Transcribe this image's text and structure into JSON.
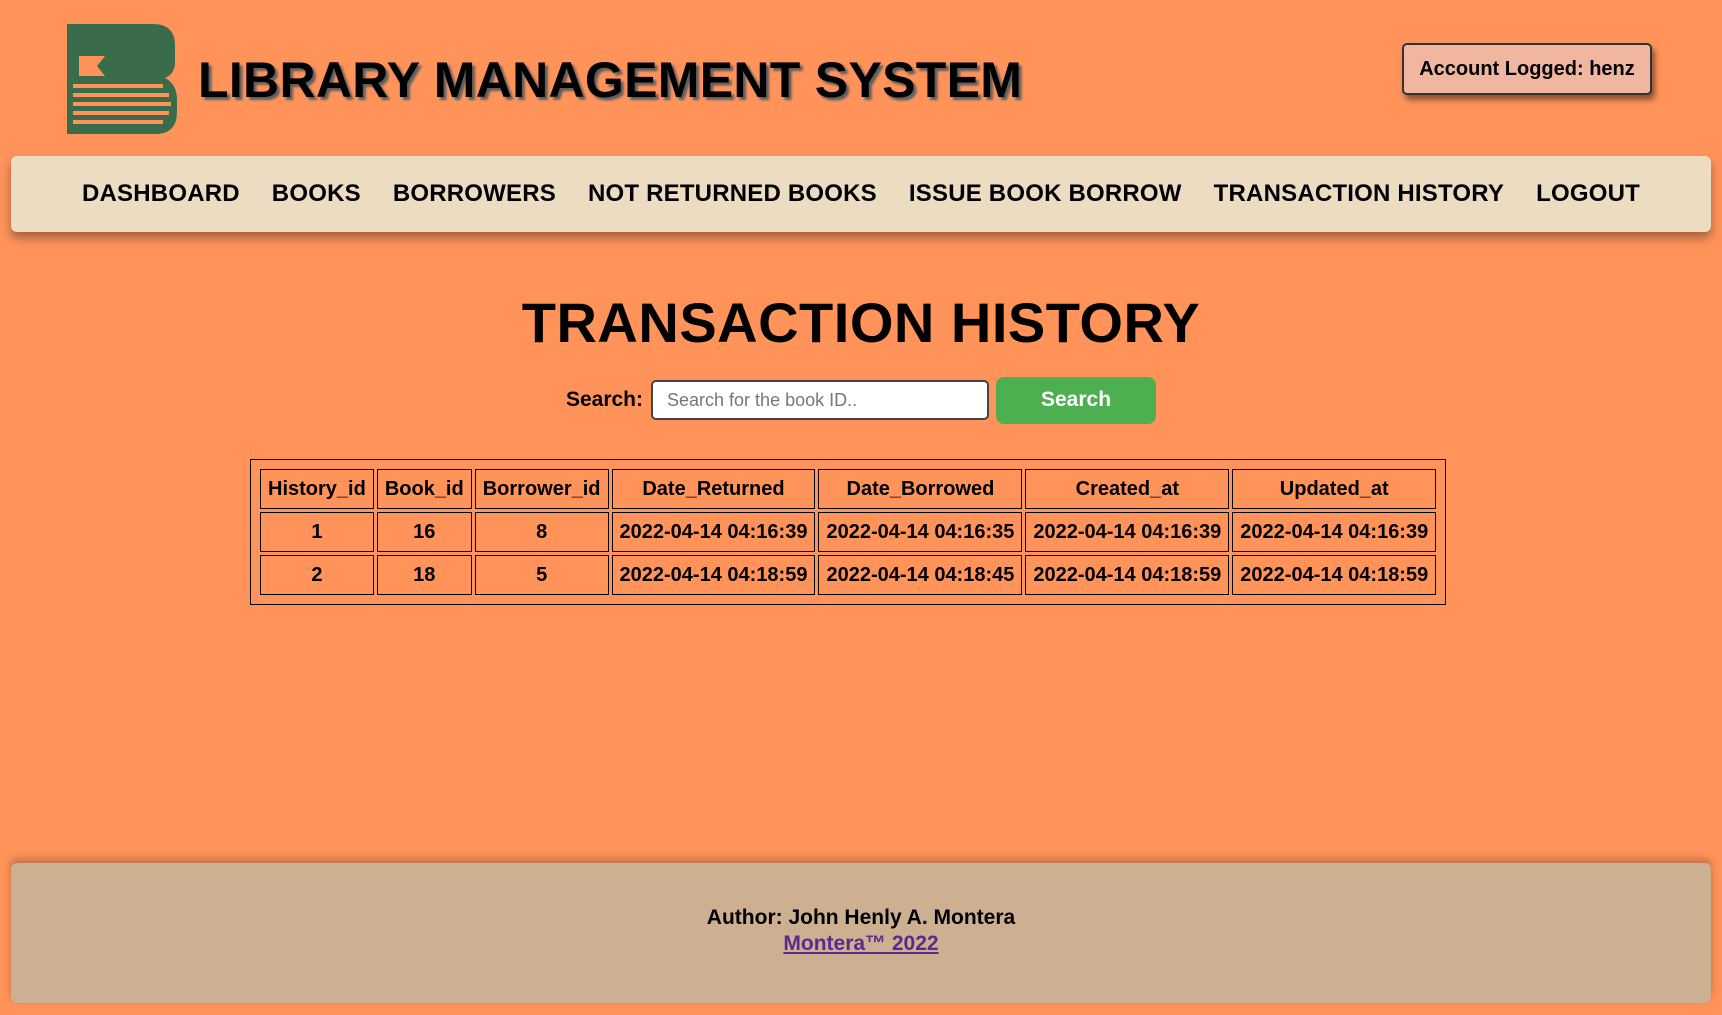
{
  "header": {
    "logo_icon": "book-logo-icon",
    "title": "LIBRARY MANAGEMENT SYSTEM",
    "account_label": "Account Logged: henz"
  },
  "nav": {
    "items": [
      {
        "label": "DASHBOARD"
      },
      {
        "label": "BOOKS"
      },
      {
        "label": "BORROWERS"
      },
      {
        "label": "NOT RETURNED BOOKS"
      },
      {
        "label": "ISSUE BOOK BORROW"
      },
      {
        "label": "TRANSACTION HISTORY"
      },
      {
        "label": "LOGOUT"
      }
    ]
  },
  "main": {
    "title": "TRANSACTION HISTORY",
    "search": {
      "label": "Search:",
      "placeholder": "Search for the book ID..",
      "value": "",
      "button_label": "Search"
    },
    "table": {
      "columns": [
        "History_id",
        "Book_id",
        "Borrower_id",
        "Date_Returned",
        "Date_Borrowed",
        "Created_at",
        "Updated_at"
      ],
      "rows": [
        [
          "1",
          "16",
          "8",
          "2022-04-14 04:16:39",
          "2022-04-14 04:16:35",
          "2022-04-14 04:16:39",
          "2022-04-14 04:16:39"
        ],
        [
          "2",
          "18",
          "5",
          "2022-04-14 04:18:59",
          "2022-04-14 04:18:45",
          "2022-04-14 04:18:59",
          "2022-04-14 04:18:59"
        ]
      ]
    }
  },
  "footer": {
    "author": "Author: John Henly A. Montera",
    "link_text": "Montera™ 2022"
  },
  "colors": {
    "background": "#FF935A",
    "nav_background": "#ECDCC2",
    "footer_background": "#CDB092",
    "account_background": "#F0B6A0",
    "search_button": "#4CAF50",
    "logo_green": "#3A6B4A",
    "footer_link": "#5B2A8C"
  }
}
